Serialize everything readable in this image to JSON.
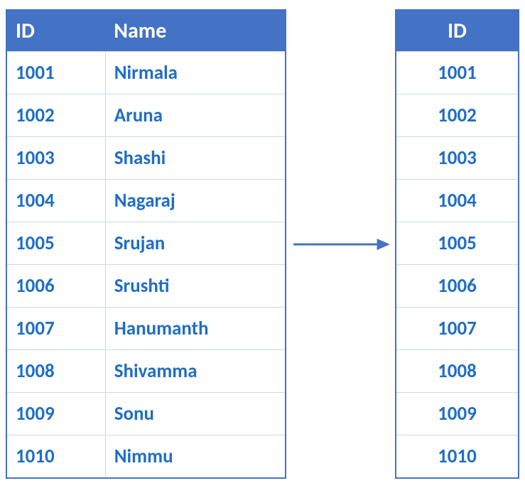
{
  "leftTable": {
    "headers": {
      "id": "ID",
      "name": "Name"
    },
    "rows": [
      {
        "id": "1001",
        "name": "Nirmala"
      },
      {
        "id": "1002",
        "name": "Aruna"
      },
      {
        "id": "1003",
        "name": "Shashi"
      },
      {
        "id": "1004",
        "name": "Nagaraj"
      },
      {
        "id": "1005",
        "name": "Srujan"
      },
      {
        "id": "1006",
        "name": "Srushti"
      },
      {
        "id": "1007",
        "name": "Hanumanth"
      },
      {
        "id": "1008",
        "name": "Shivamma"
      },
      {
        "id": "1009",
        "name": "Sonu"
      },
      {
        "id": "1010",
        "name": "Nimmu"
      }
    ]
  },
  "rightTable": {
    "headers": {
      "id": "ID"
    },
    "rows": [
      {
        "id": "1001"
      },
      {
        "id": "1002"
      },
      {
        "id": "1003"
      },
      {
        "id": "1004"
      },
      {
        "id": "1005"
      },
      {
        "id": "1006"
      },
      {
        "id": "1007"
      },
      {
        "id": "1008"
      },
      {
        "id": "1009"
      },
      {
        "id": "1010"
      }
    ]
  },
  "colors": {
    "headerBg": "#4472c4",
    "headerText": "#ffffff",
    "dataText": "#1f6ec4",
    "gridline": "#d0d7e5",
    "border": "#4472c4",
    "arrow": "#4472c4"
  }
}
